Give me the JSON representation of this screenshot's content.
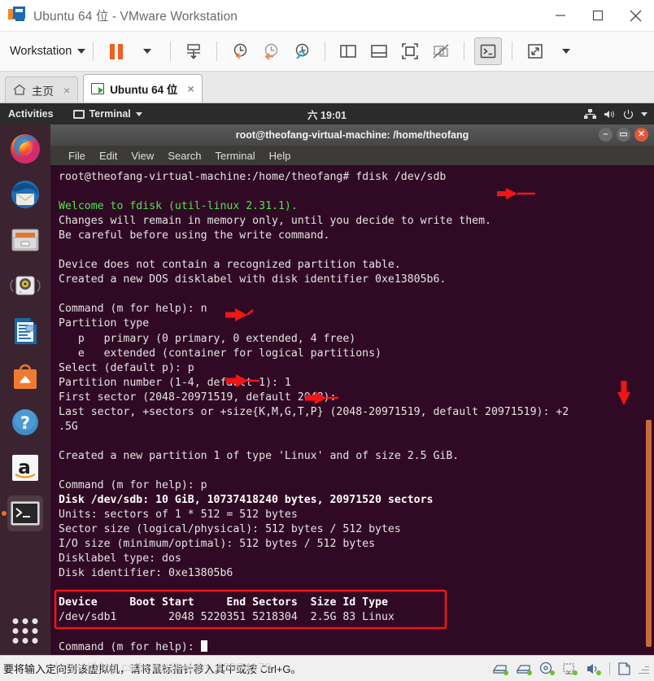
{
  "window": {
    "title": "Ubuntu 64 位 - VMware Workstation",
    "minimize_label": "最小化",
    "maximize_label": "最大化",
    "close_label": "关闭"
  },
  "toolbar": {
    "workstation_label": "Workstation",
    "buttons": [
      {
        "name": "suspend-button",
        "icon": "pause-icon"
      },
      {
        "name": "suspend-dropdown",
        "icon": "caret-down-icon"
      },
      {
        "name": "power-on-button",
        "icon": "power-on-icon"
      },
      {
        "name": "snapshot-take-button",
        "icon": "snapshot-add-icon"
      },
      {
        "name": "snapshot-revert-button",
        "icon": "snapshot-revert-icon"
      },
      {
        "name": "snapshot-manager-button",
        "icon": "snapshot-manager-icon"
      },
      {
        "name": "show-library-button",
        "icon": "panel-left-icon"
      },
      {
        "name": "show-thumbnail-button",
        "icon": "panel-bottom-icon"
      },
      {
        "name": "full-screen-button",
        "icon": "fullscreen-icon"
      },
      {
        "name": "unity-mode-button",
        "icon": "unity-disabled-icon"
      },
      {
        "name": "console-view-button",
        "icon": "console-icon"
      },
      {
        "name": "stretch-button",
        "icon": "stretch-icon"
      },
      {
        "name": "stretch-dropdown",
        "icon": "caret-down-icon"
      }
    ]
  },
  "tabs": [
    {
      "label": "主页",
      "icon": "home-icon",
      "selected": false,
      "close": "×"
    },
    {
      "label": "Ubuntu 64 位",
      "icon": "vm-running-icon",
      "selected": true,
      "close": "×"
    }
  ],
  "guest": {
    "topbar": {
      "activities": "Activities",
      "app_name": "Terminal",
      "clock": "六 19:01",
      "tray": [
        "network-icon",
        "volume-icon",
        "power-icon",
        "caret-down-icon"
      ]
    },
    "dock": [
      {
        "name": "firefox",
        "icon": "firefox-icon",
        "running": false
      },
      {
        "name": "thunderbird",
        "icon": "thunderbird-icon",
        "running": false
      },
      {
        "name": "files",
        "icon": "files-icon",
        "running": false
      },
      {
        "name": "rhythmbox",
        "icon": "rhythmbox-icon",
        "running": false
      },
      {
        "name": "libreoffice-writer",
        "icon": "libreoffice-writer-icon",
        "running": false
      },
      {
        "name": "ubuntu-software",
        "icon": "ubuntu-software-icon",
        "running": false
      },
      {
        "name": "help",
        "icon": "help-icon",
        "running": false
      },
      {
        "name": "amazon",
        "icon": "amazon-icon",
        "running": false
      },
      {
        "name": "terminal",
        "icon": "terminal-icon",
        "running": true
      }
    ],
    "show_apps_label": "Show Applications",
    "terminal": {
      "title": "root@theofang-virtual-machine: /home/theofang",
      "menu": [
        "File",
        "Edit",
        "View",
        "Search",
        "Terminal",
        "Help"
      ],
      "lines": [
        {
          "t": "prompt",
          "text": "root@theofang-virtual-machine:/home/theofang# fdisk /dev/sdb"
        },
        {
          "t": "blank",
          "text": ""
        },
        {
          "t": "green",
          "text": "Welcome to fdisk (util-linux 2.31.1)."
        },
        {
          "t": "plain",
          "text": "Changes will remain in memory only, until you decide to write them."
        },
        {
          "t": "plain",
          "text": "Be careful before using the write command."
        },
        {
          "t": "blank",
          "text": ""
        },
        {
          "t": "plain",
          "text": "Device does not contain a recognized partition table."
        },
        {
          "t": "plain",
          "text": "Created a new DOS disklabel with disk identifier 0xe13805b6."
        },
        {
          "t": "blank",
          "text": ""
        },
        {
          "t": "plain",
          "text": "Command (m for help): n"
        },
        {
          "t": "plain",
          "text": "Partition type"
        },
        {
          "t": "plain",
          "text": "   p   primary (0 primary, 0 extended, 4 free)"
        },
        {
          "t": "plain",
          "text": "   e   extended (container for logical partitions)"
        },
        {
          "t": "plain",
          "text": "Select (default p): p"
        },
        {
          "t": "plain",
          "text": "Partition number (1-4, default 1): 1"
        },
        {
          "t": "plain",
          "text": "First sector (2048-20971519, default 2048): "
        },
        {
          "t": "plain",
          "text": "Last sector, +sectors or +size{K,M,G,T,P} (2048-20971519, default 20971519): +2"
        },
        {
          "t": "plain",
          "text": ".5G"
        },
        {
          "t": "blank",
          "text": ""
        },
        {
          "t": "plain",
          "text": "Created a new partition 1 of type 'Linux' and of size 2.5 GiB."
        },
        {
          "t": "blank",
          "text": ""
        },
        {
          "t": "plain",
          "text": "Command (m for help): p"
        },
        {
          "t": "bold",
          "text": "Disk /dev/sdb: 10 GiB, 10737418240 bytes, 20971520 sectors"
        },
        {
          "t": "plain",
          "text": "Units: sectors of 1 * 512 = 512 bytes"
        },
        {
          "t": "plain",
          "text": "Sector size (logical/physical): 512 bytes / 512 bytes"
        },
        {
          "t": "plain",
          "text": "I/O size (minimum/optimal): 512 bytes / 512 bytes"
        },
        {
          "t": "plain",
          "text": "Disklabel type: dos"
        },
        {
          "t": "plain",
          "text": "Disk identifier: 0xe13805b6"
        },
        {
          "t": "blank",
          "text": ""
        },
        {
          "t": "bold",
          "text": "Device     Boot Start     End Sectors  Size Id Type"
        },
        {
          "t": "plain",
          "text": "/dev/sdb1        2048 5220351 5218304  2.5G 83 Linux"
        },
        {
          "t": "blank",
          "text": ""
        },
        {
          "t": "prompt2",
          "text": "Command (m for help): "
        }
      ],
      "cursor": "block-cursor"
    }
  },
  "annotations": {
    "color": "#f01616",
    "arrows": [
      {
        "name": "arrow-fdisk-command",
        "dir": "left"
      },
      {
        "name": "arrow-new-command",
        "dir": "left"
      },
      {
        "name": "arrow-select-primary",
        "dir": "left"
      },
      {
        "name": "arrow-partition-number",
        "dir": "left"
      },
      {
        "name": "arrow-last-sector-size",
        "dir": "down"
      }
    ],
    "boxes": [
      {
        "name": "highlight-partition-table"
      }
    ]
  },
  "statusbar": {
    "hint": "要将输入定向到该虚拟机，请将鼠标指针移入其中或按 Ctrl+G。",
    "watermark": "https://blog.csdn.net/weixin_43994179",
    "devices": [
      {
        "name": "hard-disk-1-icon"
      },
      {
        "name": "hard-disk-2-icon"
      },
      {
        "name": "cd-dvd-icon"
      },
      {
        "name": "network-adapter-icon"
      },
      {
        "name": "sound-card-icon"
      },
      {
        "name": "printer-icon"
      }
    ]
  }
}
